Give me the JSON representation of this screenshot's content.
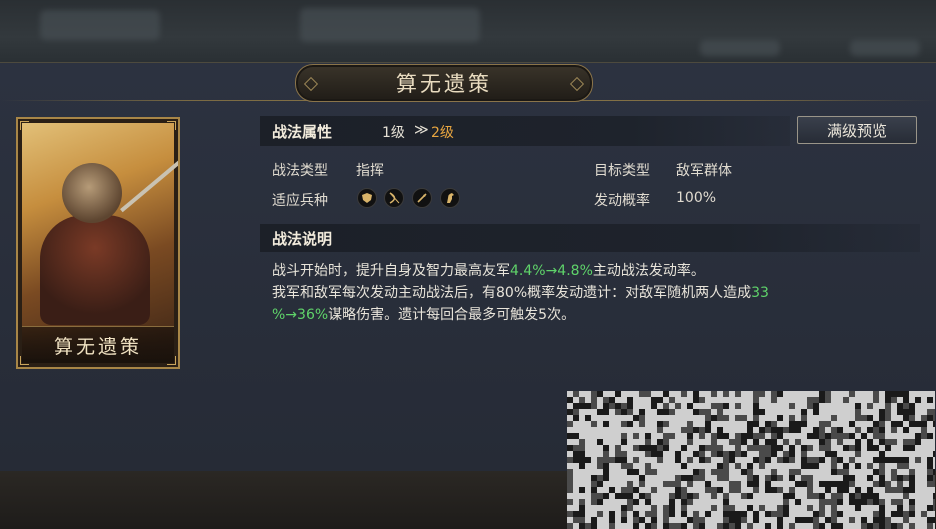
{
  "title": "算无遗策",
  "card": {
    "label": "算无遗策"
  },
  "attributes": {
    "header": "战法属性",
    "level_from": "1级",
    "level_arrow": "≫",
    "level_to": "2级",
    "preview_button": "满级预览",
    "type_label": "战法类型",
    "type_value": "指挥",
    "target_label": "目标类型",
    "target_value": "敌军群体",
    "troops_label": "适应兵种",
    "troop_icons": [
      "shield-icon",
      "bow-icon",
      "spear-icon",
      "horse-icon"
    ],
    "rate_label": "发动概率",
    "rate_value": "100%"
  },
  "description": {
    "header": "战法说明",
    "line1_a": "战斗开始时，提升自身及智力最高友军",
    "line1_b": "4.4%→4.8%",
    "line1_c": "主动战法发动率。",
    "line2_a": "我军和敌军每次发动主动战法后，有80%概率发动遗计：对敌军随机两人造成",
    "line2_b": "33",
    "line3_a": "%→36%",
    "line3_b": "谋略伤害。遗计每回合最多可触发5次。"
  },
  "colors": {
    "accent_gold": "#caa55c",
    "level_to": "#e8a640",
    "highlight_green": "#5fd36a"
  }
}
